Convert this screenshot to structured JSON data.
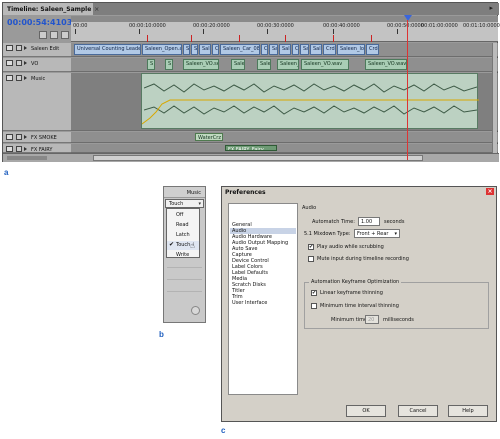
{
  "panel_labels": {
    "a": "a",
    "b": "b",
    "c": "c"
  },
  "timeline": {
    "tab_title": "Timeline: Saleen_Sample",
    "tab_close": "×",
    "timecode": "00:00:54:41030",
    "ruler_labels": [
      "00:00",
      "00:00:10:0000",
      "00:00:20:0000",
      "00:00:30:0000",
      "00:00:40:0000",
      "00:00:50:0000",
      "00:01:00:0000",
      "00:01:10:0000"
    ],
    "tracks": {
      "saleen_edit": "Saleen Edit",
      "vo": "VO",
      "music": "Music",
      "fx_smoke": "FX SMOKE",
      "fx_fairy": "FX FAIRY"
    },
    "video_clips": [
      "Universal Counting Leader",
      "Saleen_Open.a",
      "S",
      "S",
      "Sal",
      "C",
      "Saleen_Car_08",
      "C",
      "Sa",
      "Sal",
      "C",
      "Sa",
      "Sal",
      "Crde",
      "Saleen_log",
      "Crde"
    ],
    "vo_clips": [
      "S",
      "S",
      "Saleen_VO.sec",
      "Sale",
      "Sale",
      "Saleen_",
      "Saleen_VO.wav",
      "Saleen_VO.wav"
    ],
    "smoke_clip": "WaterCrz",
    "fairy_clip": "FX FAIRY_Fairy"
  },
  "automation": {
    "track_name": "Music",
    "selected": "Touch",
    "options": [
      "Off",
      "Read",
      "Latch",
      "Touch",
      "Write"
    ],
    "checked_option": "Touch",
    "check_mark": "✔",
    "cursor_glyph": "☝"
  },
  "preferences": {
    "title": "Preferences",
    "close": "×",
    "categories": [
      "General",
      "Audio",
      "Audio Hardware",
      "Audio Output Mapping",
      "Auto Save",
      "Capture",
      "Device Control",
      "Label Colors",
      "Label Defaults",
      "Media",
      "Scratch Disks",
      "Titler",
      "Trim",
      "User Interface"
    ],
    "selected_category": "Audio",
    "section_title": "Audio",
    "automatch_label": "Automatch Time:",
    "automatch_value": "1.00",
    "automatch_unit": "seconds",
    "mixdown_label": "5.1 Mixdown Type:",
    "mixdown_value": "Front + Rear",
    "play_scrubbing_label": "Play audio while scrubbing",
    "play_scrubbing_checked": true,
    "mute_input_label": "Mute input during timeline recording",
    "mute_input_checked": false,
    "kf_group_title": "Automation Keyframe Optimization",
    "linear_thinning_label": "Linear keyframe thinning",
    "linear_thinning_checked": true,
    "min_interval_label": "Minimum time interval thinning",
    "min_interval_checked": false,
    "min_time_label": "Minimum time:",
    "min_time_value": "20",
    "min_time_unit": "milliseconds",
    "ok_label": "OK",
    "cancel_label": "Cancel",
    "help_label": "Help",
    "check_glyph": "✔"
  }
}
